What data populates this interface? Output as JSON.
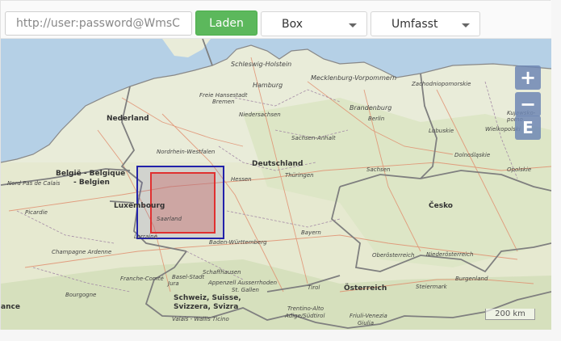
{
  "toolbar": {
    "url_placeholder": "http://user:password@WmsC",
    "load_label": "Laden",
    "box_select": "Box",
    "mode_select": "Umfasst"
  },
  "map": {
    "scale_label": "200 km",
    "zoom_in": "+",
    "zoom_out": "−",
    "zoom_extent": "E",
    "labels": {
      "schleswig": "Schleswig-Holstein",
      "hamburg": "Hamburg",
      "mecklenburg": "Mecklenburg-Vorpommern",
      "zachodnio": "Zachodniopomorskie",
      "kujawsko": "Kujawsko-pomo",
      "bremen_state": "Freie Hansestadt",
      "bremen": "Bremen",
      "brandenburg": "Brandenburg",
      "berlin": "Berlin",
      "niedersachsen": "Niedersachsen",
      "nederland": "Nederland",
      "lubuskie": "Lubuskie",
      "wielkopolskie": "Wielkopolski",
      "sachsen_anhalt": "Sachsen-Anhalt",
      "nordrhein": "Nordrhein-Westfalen",
      "dolnoslaskie": "Dolnośląskie",
      "deutschland": "Deutschland",
      "belgie": "België - Belgique",
      "belgien": "- Belgien",
      "nordpas": "Nord Pas de Calais",
      "hessen": "Hessen",
      "thueringen": "Thüringen",
      "sachsen": "Sachsen",
      "opolskie": "Opolskie",
      "luxembourg": "Luxembourg",
      "cesko": "Česko",
      "picardie": "Picardie",
      "saarland": "Saarland",
      "lorraine": "Lorraine",
      "baden": "Baden-Württemberg",
      "bayern": "Bayern",
      "champagne": "Champagne Ardenne",
      "oberoesterreich": "Oberösterreich",
      "niederoesterreich": "Niederösterreich",
      "franche": "Franche-Comté",
      "schaffhausen": "Schaffhausen",
      "basel": "Basel-Stadt",
      "jura": "Jura",
      "appenzell": "Appenzell Ausserrhoden",
      "stgallen": "St. Gallen",
      "burgenland": "Burgenland",
      "steiermark": "Steiermark",
      "tirol": "Tirol",
      "oesterreich": "Österreich",
      "bourgogne": "Bourgogne",
      "schweiz1": "Schweiz, Suisse,",
      "schweiz2": "Svizzera, Svizra",
      "trentino1": "Trentino-Alto",
      "trentino2": "Adige/Südtirol",
      "friuli1": "Friuli-Venezia",
      "friuli2": "Giulia",
      "france": "ance",
      "valais": "Valais - Wallis",
      "ticino": "Ticino"
    }
  }
}
